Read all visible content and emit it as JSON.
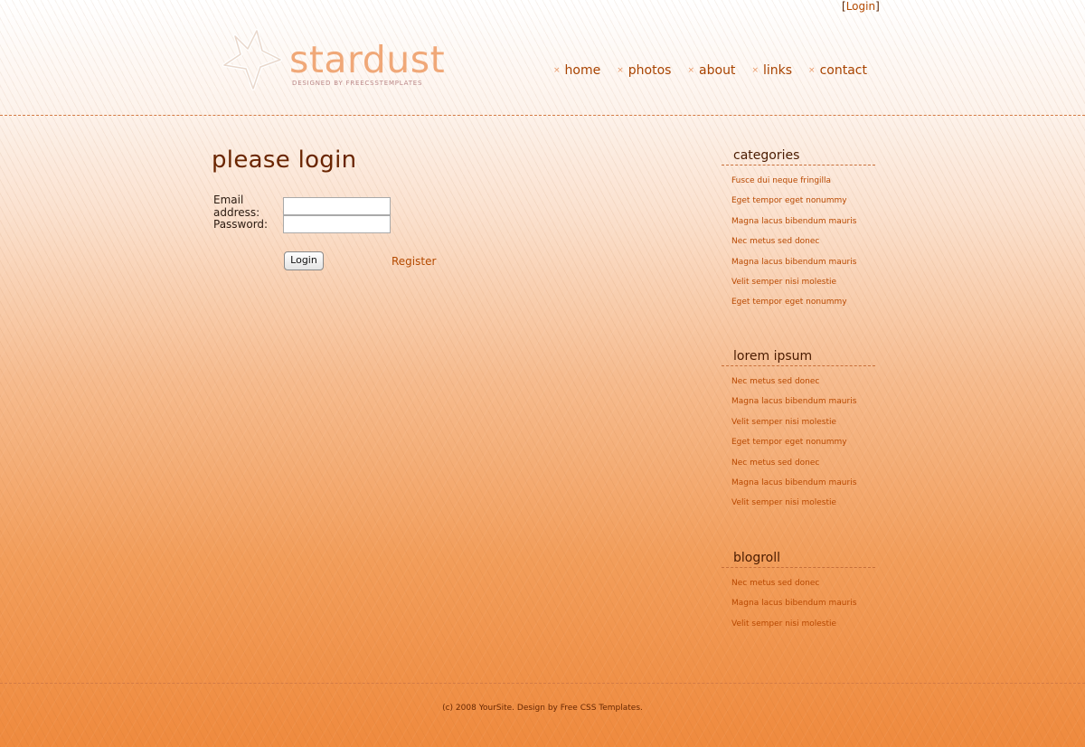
{
  "top": {
    "bracket_open": "[",
    "login_link": "Login",
    "bracket_close": "]"
  },
  "logo": {
    "title": "stardust",
    "subtitle": "DESIGNED BY FREECSSTEMPLATES"
  },
  "nav": {
    "bullet": "×",
    "items": [
      "home",
      "photos",
      "about",
      "links",
      "contact"
    ]
  },
  "main": {
    "title": "please login",
    "email_label": "Email address:",
    "email_value": "",
    "password_label": "Password:",
    "password_value": "",
    "login_button": "Login",
    "register_link": "Register"
  },
  "sidebar": {
    "categories": {
      "title": "categories",
      "items": [
        "Fusce dui neque fringilla",
        "Eget tempor eget nonummy",
        "Magna lacus bibendum mauris",
        "Nec metus sed donec",
        "Magna lacus bibendum mauris",
        "Velit semper nisi molestie",
        "Eget tempor eget nonummy"
      ]
    },
    "lorem": {
      "title": "lorem ipsum",
      "items": [
        "Nec metus sed donec",
        "Magna lacus bibendum mauris",
        "Velit semper nisi molestie",
        "Eget tempor eget nonummy",
        "Nec metus sed donec",
        "Magna lacus bibendum mauris",
        "Velit semper nisi molestie"
      ]
    },
    "blogroll": {
      "title": "blogroll",
      "items": [
        "Nec metus sed donec",
        "Magna lacus bibendum mauris",
        "Velit semper nisi molestie"
      ]
    }
  },
  "footer": {
    "text": "(c) 2008 YourSite. Design by Free CSS Templates."
  },
  "colors": {
    "accent": "#b44a00",
    "heading": "#6a2500",
    "logo": "#f0a878"
  }
}
